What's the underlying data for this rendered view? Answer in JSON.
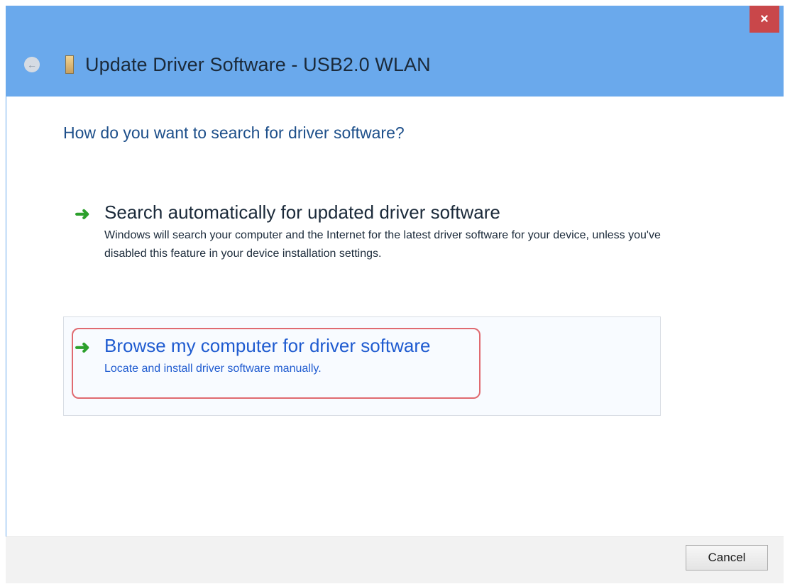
{
  "window": {
    "title": "Update Driver Software - USB2.0 WLAN",
    "close_glyph": "×",
    "back_glyph": "←"
  },
  "content": {
    "heading": "How do you want to search for driver software?",
    "options": [
      {
        "title": "Search automatically for updated driver software",
        "description": "Windows will search your computer and the Internet for the latest driver software for your device, unless you've disabled this feature in your device installation settings.",
        "icon": "green-arrow-icon"
      },
      {
        "title": "Browse my computer for driver software",
        "description": "Locate and install driver software manually.",
        "icon": "green-arrow-icon"
      }
    ]
  },
  "footer": {
    "cancel_label": "Cancel"
  },
  "colors": {
    "titlebar": "#6aa9ec",
    "accent_link": "#1f5bd0",
    "arrow": "#2ca02c",
    "highlight": "#e06a70"
  }
}
